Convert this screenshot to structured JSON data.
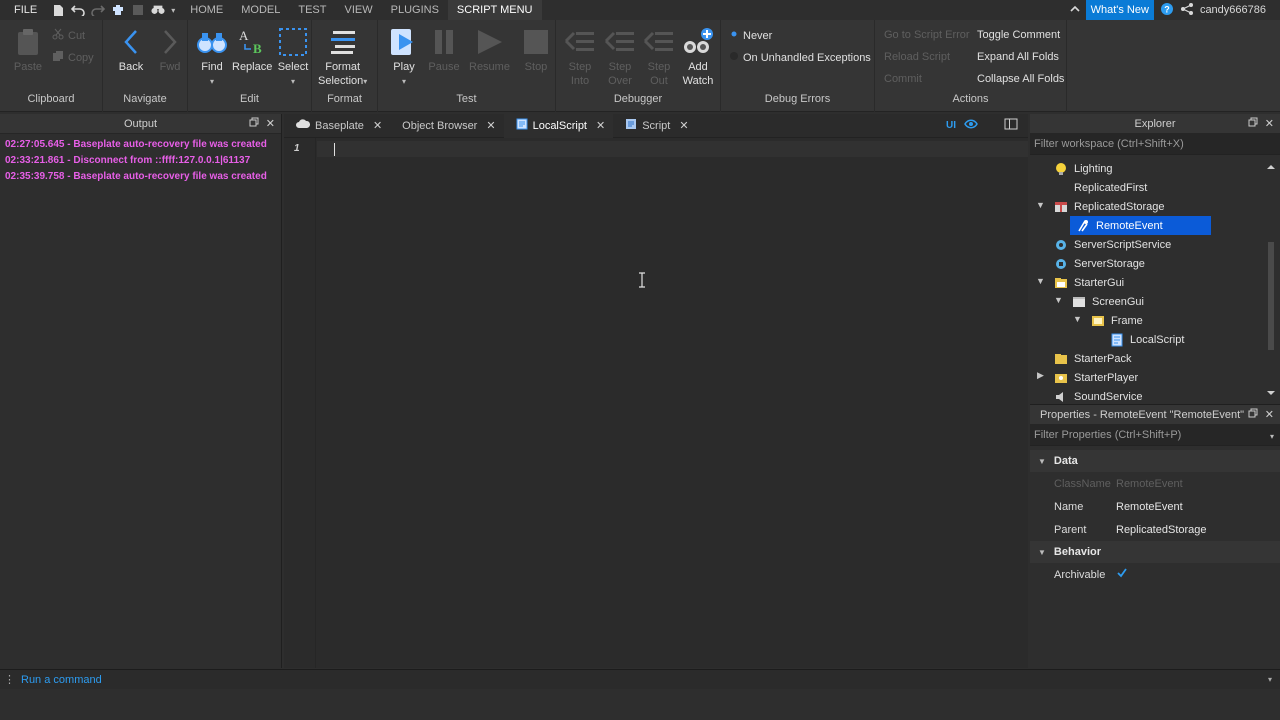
{
  "menubar": {
    "file": "FILE",
    "tabs": [
      "HOME",
      "MODEL",
      "TEST",
      "VIEW",
      "PLUGINS",
      "SCRIPT MENU"
    ],
    "active_tab": "SCRIPT MENU",
    "whats_new": "What's New",
    "username": "candy666786"
  },
  "ribbon": {
    "clipboard": {
      "label": "Clipboard",
      "paste": "Paste",
      "cut": "Cut",
      "copy": "Copy"
    },
    "navigate": {
      "label": "Navigate",
      "back": "Back",
      "fwd": "Fwd"
    },
    "edit": {
      "label": "Edit",
      "find": "Find",
      "replace": "Replace",
      "select": "Select"
    },
    "format": {
      "label": "Format",
      "format_selection": "Format",
      "format_selection2": "Selection"
    },
    "test": {
      "label": "Test",
      "play": "Play",
      "pause": "Pause",
      "resume": "Resume",
      "stop": "Stop"
    },
    "debugger": {
      "label": "Debugger",
      "step_into": "Step",
      "step_into2": "Into",
      "step_over": "Step",
      "step_over2": "Over",
      "step_out": "Step",
      "step_out2": "Out",
      "add_watch": "Add",
      "add_watch2": "Watch"
    },
    "debug_errors": {
      "label": "Debug Errors",
      "never": "Never",
      "on_unhandled": "On Unhandled Exceptions"
    },
    "actions": {
      "label": "Actions",
      "go_to_error": "Go to Script Error",
      "reload_script": "Reload Script",
      "commit": "Commit",
      "toggle_comment": "Toggle Comment",
      "expand_all": "Expand All Folds",
      "collapse_all": "Collapse All Folds"
    }
  },
  "output": {
    "title": "Output",
    "lines": [
      "02:27:05.645 - Baseplate auto-recovery file was created",
      "02:33:21.861 - Disconnect from ::ffff:127.0.0.1|61137",
      "02:35:39.758 - Baseplate auto-recovery file was created"
    ],
    "line_color": "#e85fe8"
  },
  "editor": {
    "tabs": [
      {
        "label": "Baseplate",
        "icon": "cloud-icon"
      },
      {
        "label": "Object Browser",
        "icon": "none"
      },
      {
        "label": "LocalScript",
        "icon": "local-script-icon"
      },
      {
        "label": "Script",
        "icon": "script-icon"
      }
    ],
    "active_tab": "LocalScript",
    "ui_label": "UI",
    "line_number": "1"
  },
  "explorer": {
    "title": "Explorer",
    "filter_placeholder": "Filter workspace (Ctrl+Shift+X)",
    "items": [
      {
        "label": "Lighting",
        "icon": "lightbulb-icon"
      },
      {
        "label": "ReplicatedFirst",
        "icon": "replicated-first-icon"
      },
      {
        "label": "ReplicatedStorage",
        "icon": "replicated-storage-icon"
      },
      {
        "label": "RemoteEvent",
        "icon": "remote-event-icon"
      },
      {
        "label": "ServerScriptService",
        "icon": "server-script-service-icon"
      },
      {
        "label": "ServerStorage",
        "icon": "server-storage-icon"
      },
      {
        "label": "StarterGui",
        "icon": "starter-gui-icon"
      },
      {
        "label": "ScreenGui",
        "icon": "screen-gui-icon"
      },
      {
        "label": "Frame",
        "icon": "frame-icon"
      },
      {
        "label": "LocalScript",
        "icon": "local-script-icon"
      },
      {
        "label": "StarterPack",
        "icon": "starter-pack-icon"
      },
      {
        "label": "StarterPlayer",
        "icon": "starter-player-icon"
      },
      {
        "label": "SoundService",
        "icon": "sound-service-icon"
      }
    ],
    "selected": "RemoteEvent",
    "selection_color": "#0b5bd8"
  },
  "properties": {
    "title": "Properties - RemoteEvent \"RemoteEvent\"",
    "filter_placeholder": "Filter Properties (Ctrl+Shift+P)",
    "data_category": "Data",
    "classname_label": "ClassName",
    "classname_value": "RemoteEvent",
    "name_label": "Name",
    "name_value": "RemoteEvent",
    "parent_label": "Parent",
    "parent_value": "ReplicatedStorage",
    "behavior_category": "Behavior",
    "archivable_label": "Archivable",
    "archivable_checked": true
  },
  "command_bar": {
    "placeholder": "Run a command"
  }
}
